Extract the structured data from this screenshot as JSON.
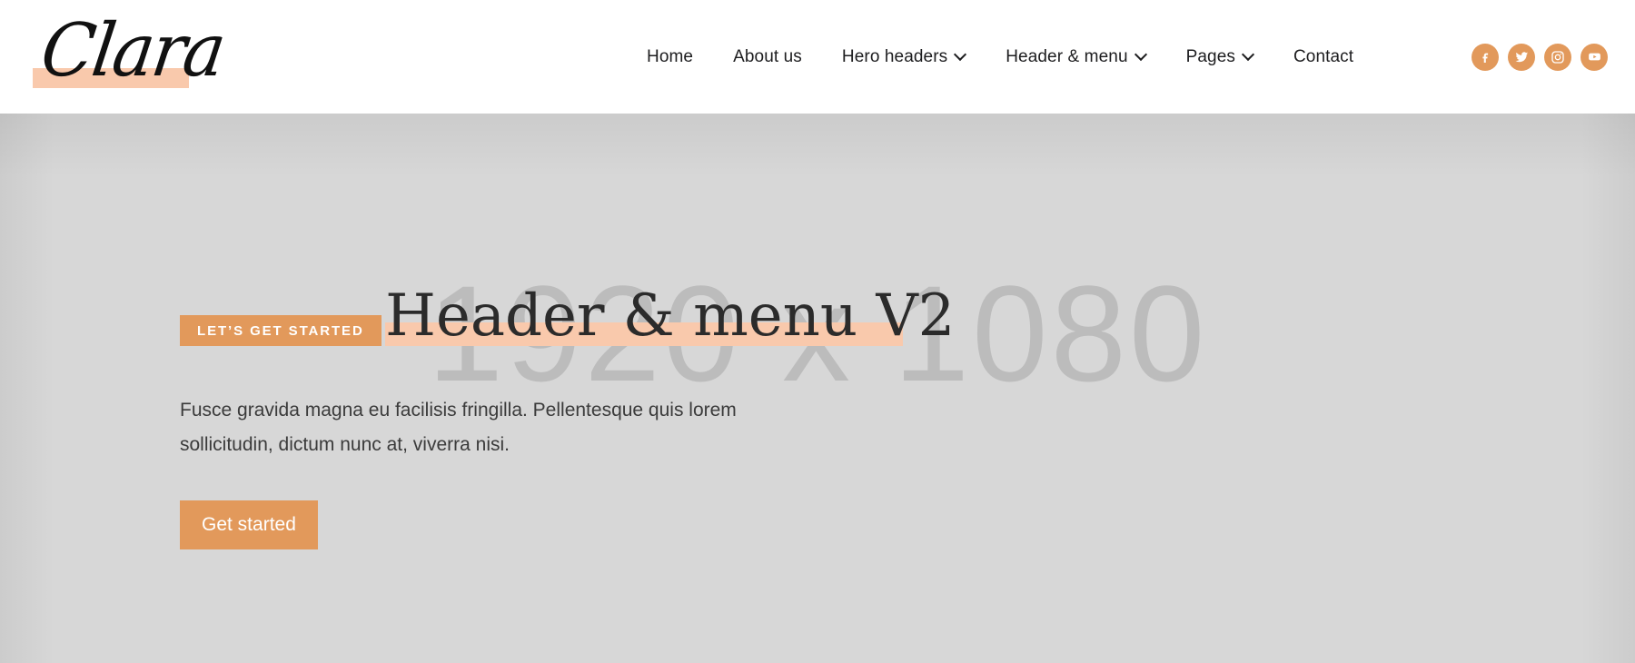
{
  "header": {
    "logo": {
      "text": "Clara",
      "highlight_color": "#F9C9AC"
    },
    "nav": [
      {
        "label": "Home",
        "has_dropdown": false
      },
      {
        "label": "About us",
        "has_dropdown": false
      },
      {
        "label": "Hero headers",
        "has_dropdown": true
      },
      {
        "label": "Header & menu",
        "has_dropdown": true
      },
      {
        "label": "Pages",
        "has_dropdown": true
      },
      {
        "label": "Contact",
        "has_dropdown": false
      }
    ],
    "social": [
      {
        "name": "facebook-icon",
        "label": "Facebook"
      },
      {
        "name": "twitter-icon",
        "label": "Twitter"
      },
      {
        "name": "instagram-icon",
        "label": "Instagram"
      },
      {
        "name": "youtube-icon",
        "label": "YouTube"
      }
    ],
    "background_color": "#ffffff"
  },
  "hero": {
    "placeholder_text": "1920 x 1080",
    "background_color": "#d7d7d7",
    "eyebrow": "LET’S GET STARTED",
    "title": "Header & menu V2",
    "paragraph": "Fusce gravida magna eu facilisis fringilla. Pellentesque quis lorem sollicitudin, dictum nunc at, viverra nisi.",
    "button_label": "Get started"
  },
  "theme": {
    "accent": "#E2995B",
    "highlight": "#F9C9AC",
    "text_dark": "#1d1d1f",
    "placeholder_grey": "#bcbcbc"
  }
}
